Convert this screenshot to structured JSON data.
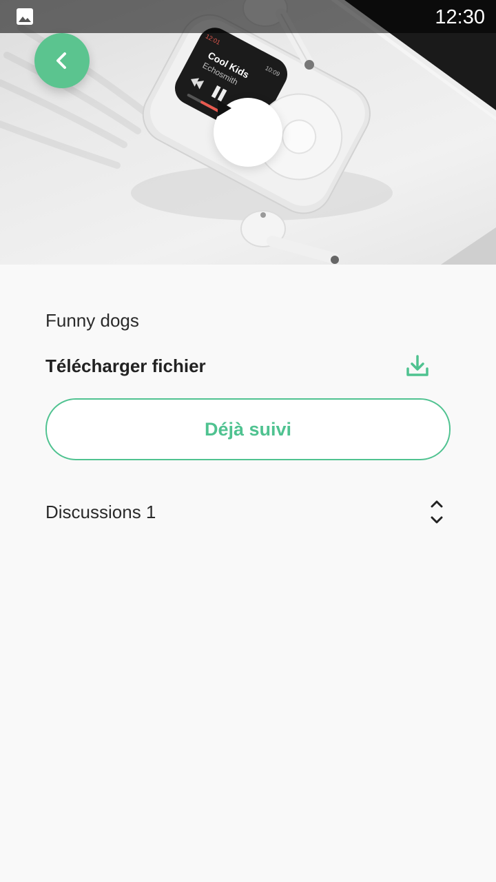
{
  "status_bar": {
    "time": "12:30",
    "notification_icon": "image-icon"
  },
  "hero": {
    "back_icon": "chevron-left-icon",
    "play_icon": "play-icon",
    "screen_title": "Cool Kids",
    "screen_artist": "Echosmith",
    "screen_time_left": "12:01",
    "screen_time_right": "10:09"
  },
  "content": {
    "title": "Funny dogs",
    "download_label": "Télécharger fichier",
    "download_icon": "download-icon",
    "follow_label": "Déjà suivi",
    "discussions_label": "Discussions 1",
    "discussions_toggle_icon": "expand-collapse-icon"
  },
  "colors": {
    "accent": "#4fc290",
    "back_button": "#5bc48f",
    "background": "#f9f9f9"
  }
}
